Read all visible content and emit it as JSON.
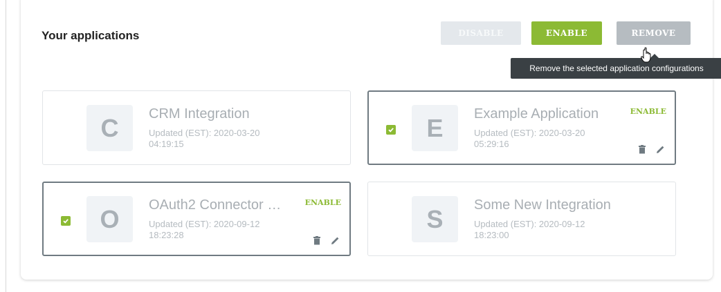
{
  "panel": {
    "title": "Your applications"
  },
  "toolbar": {
    "disable_label": "DISABLE",
    "enable_label": "ENABLE",
    "remove_label": "REMOVE"
  },
  "tooltip": {
    "text": "Remove the selected application configurations"
  },
  "applications": [
    {
      "initial": "C",
      "name": "CRM Integration",
      "updated_line1": "Updated (EST): 2020-03-20",
      "updated_line2": "04:19:15",
      "selected": false,
      "action_label": ""
    },
    {
      "initial": "E",
      "name": "Example Application",
      "updated_line1": "Updated (EST): 2020-03-20",
      "updated_line2": "05:29:16",
      "selected": true,
      "action_label": "ENABLE"
    },
    {
      "initial": "O",
      "name": "OAuth2 Connector …",
      "updated_line1": "Updated (EST): 2020-09-12",
      "updated_line2": "18:23:28",
      "selected": true,
      "action_label": "ENABLE"
    },
    {
      "initial": "S",
      "name": "Some New Integration",
      "updated_line1": "Updated (EST): 2020-09-12",
      "updated_line2": "18:23:00",
      "selected": false,
      "action_label": ""
    }
  ],
  "colors": {
    "accent_green": "#8cba34",
    "remove_gray": "#b6bcc1",
    "tooltip_bg": "#3a4044"
  },
  "icons": {
    "checkbox": "checkbox-checked-icon",
    "delete": "trash-icon",
    "edit": "pencil-icon",
    "cursor": "hand-pointer-icon"
  }
}
